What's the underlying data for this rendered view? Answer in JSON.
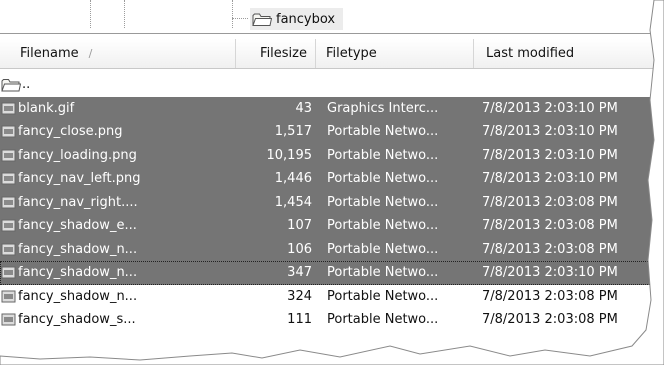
{
  "tree": {
    "folder_label": "fancybox"
  },
  "columns": {
    "filename": "Filename",
    "filesize": "Filesize",
    "filetype": "Filetype",
    "modified": "Last modified"
  },
  "parent_label": "..",
  "files": [
    {
      "name": "blank.gif",
      "size": "43",
      "type": "Graphics Interc...",
      "modified": "7/8/2013 2:03:10 PM",
      "selected": true
    },
    {
      "name": "fancy_close.png",
      "size": "1,517",
      "type": "Portable Netwo...",
      "modified": "7/8/2013 2:03:10 PM",
      "selected": true
    },
    {
      "name": "fancy_loading.png",
      "size": "10,195",
      "type": "Portable Netwo...",
      "modified": "7/8/2013 2:03:10 PM",
      "selected": true
    },
    {
      "name": "fancy_nav_left.png",
      "size": "1,446",
      "type": "Portable Netwo...",
      "modified": "7/8/2013 2:03:10 PM",
      "selected": true
    },
    {
      "name": "fancy_nav_right....",
      "size": "1,454",
      "type": "Portable Netwo...",
      "modified": "7/8/2013 2:03:08 PM",
      "selected": true
    },
    {
      "name": "fancy_shadow_e...",
      "size": "107",
      "type": "Portable Netwo...",
      "modified": "7/8/2013 2:03:08 PM",
      "selected": true
    },
    {
      "name": "fancy_shadow_n...",
      "size": "106",
      "type": "Portable Netwo...",
      "modified": "7/8/2013 2:03:08 PM",
      "selected": true
    },
    {
      "name": "fancy_shadow_n...",
      "size": "347",
      "type": "Portable Netwo...",
      "modified": "7/8/2013 2:03:10 PM",
      "selected": true,
      "focused": true
    },
    {
      "name": "fancy_shadow_n...",
      "size": "324",
      "type": "Portable Netwo...",
      "modified": "7/8/2013 2:03:08 PM",
      "selected": false
    },
    {
      "name": "fancy_shadow_s...",
      "size": "111",
      "type": "Portable Netwo...",
      "modified": "7/8/2013 2:03:08 PM",
      "selected": false
    }
  ],
  "colors": {
    "selection": "#757575",
    "folder": "#f3e6b3"
  }
}
